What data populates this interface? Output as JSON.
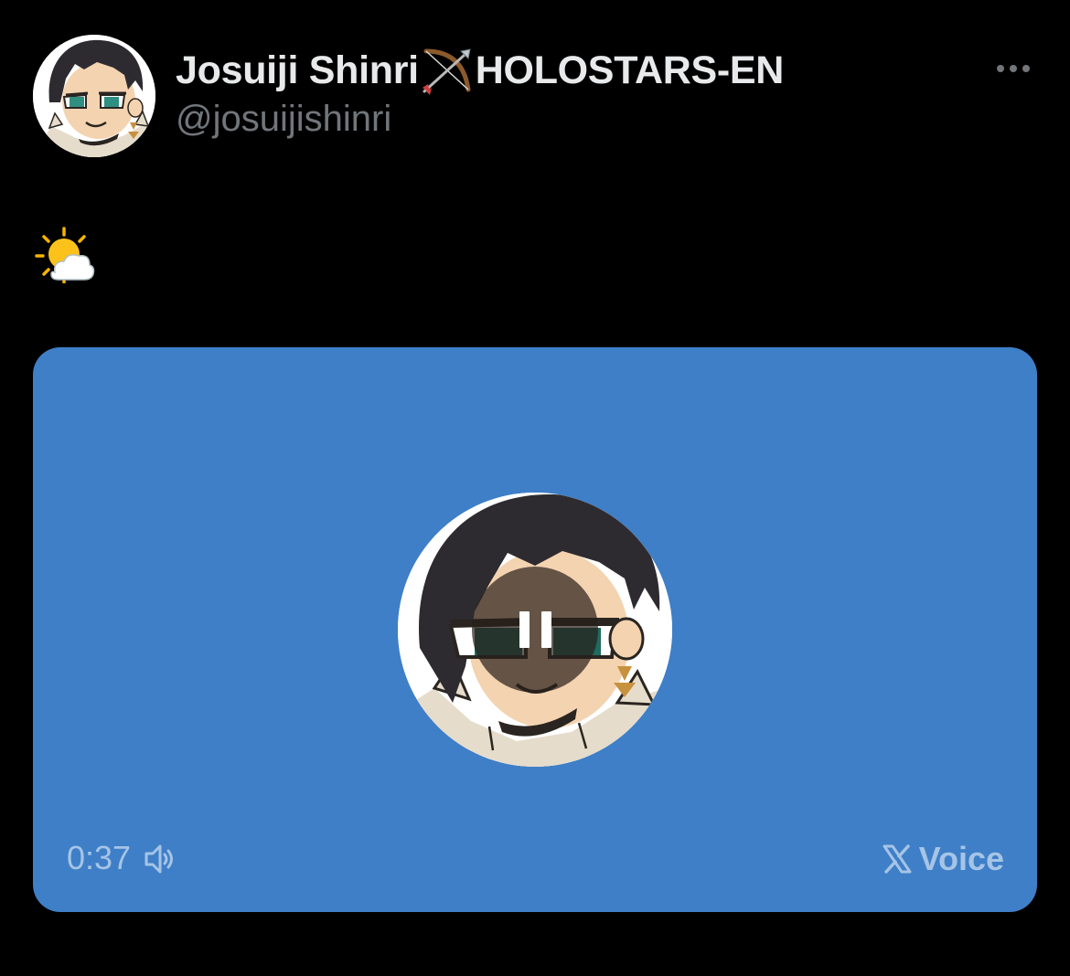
{
  "post": {
    "author": {
      "display_name": "Josuiji Shinri",
      "badge_icon": "bow-and-arrow-icon",
      "affiliation": "HOLOSTARS-EN",
      "handle": "@josuijishinri"
    },
    "more_icon": "more-options-icon",
    "text_emoji": "sun-behind-cloud-icon"
  },
  "voice": {
    "duration": "0:37",
    "state_icon": "pause-icon",
    "volume_icon": "speaker-icon",
    "brand_label": "Voice",
    "brand_icon": "x-logo-icon"
  },
  "colors": {
    "background": "#000000",
    "card_background": "#3e7fc7",
    "primary_text": "#e7e9ea",
    "secondary_text": "#71767b",
    "card_text": "#a6c4e6"
  }
}
